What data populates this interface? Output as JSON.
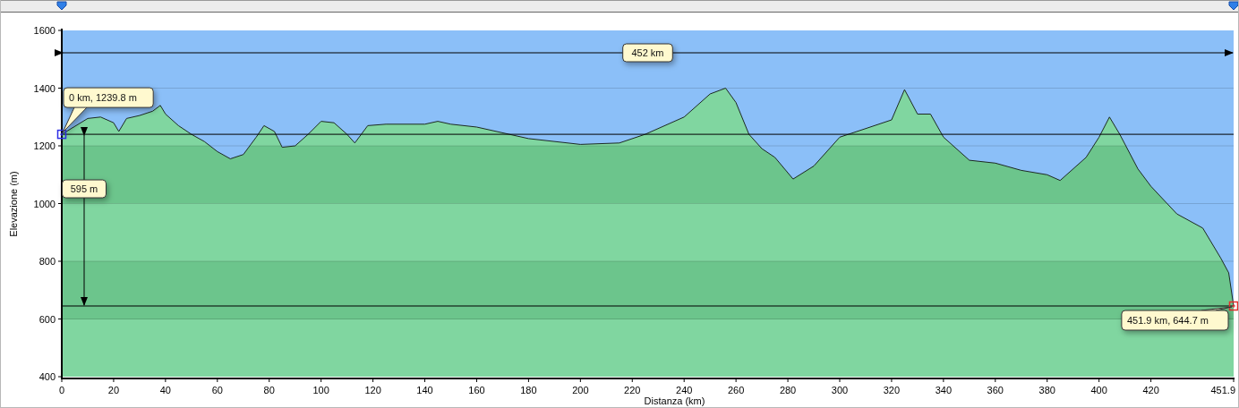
{
  "chart_data": {
    "type": "area",
    "xlabel": "Distanza   (km)",
    "ylabel": "Elevazione (m)",
    "x": [
      0,
      10,
      15,
      20,
      22,
      25,
      30,
      35,
      38,
      40,
      45,
      50,
      55,
      60,
      65,
      70,
      75,
      78,
      82,
      85,
      90,
      95,
      100,
      105,
      110,
      113,
      118,
      125,
      140,
      145,
      150,
      160,
      180,
      200,
      215,
      225,
      240,
      250,
      256,
      260,
      265,
      270,
      275,
      282,
      290,
      300,
      310,
      320,
      325,
      330,
      335,
      340,
      350,
      360,
      370,
      380,
      385,
      395,
      400,
      404,
      408,
      415,
      420,
      430,
      440,
      447,
      450,
      451.9
    ],
    "values": [
      1240,
      1295,
      1300,
      1280,
      1250,
      1295,
      1305,
      1320,
      1340,
      1310,
      1270,
      1240,
      1215,
      1180,
      1155,
      1170,
      1230,
      1270,
      1250,
      1195,
      1200,
      1240,
      1285,
      1280,
      1240,
      1210,
      1270,
      1275,
      1275,
      1285,
      1275,
      1265,
      1225,
      1205,
      1210,
      1240,
      1300,
      1380,
      1400,
      1350,
      1240,
      1190,
      1160,
      1085,
      1130,
      1230,
      1260,
      1290,
      1395,
      1310,
      1310,
      1230,
      1150,
      1140,
      1115,
      1100,
      1080,
      1160,
      1230,
      1300,
      1240,
      1120,
      1060,
      964,
      915,
      810,
      760,
      645
    ],
    "xlim": [
      0,
      451.9
    ],
    "ylim": [
      400,
      1600
    ],
    "xticks": [
      0,
      20,
      40,
      60,
      80,
      100,
      120,
      140,
      160,
      180,
      200,
      220,
      240,
      260,
      280,
      300,
      320,
      340,
      360,
      380,
      400,
      420,
      {
        "value": 451.9,
        "label": "451.9"
      }
    ],
    "yticks": [
      400,
      600,
      800,
      1000,
      1200,
      1400,
      1600
    ],
    "grid": true,
    "annotations": [
      "0 km, 1239.8 m",
      "451.9 km, 644.7 m",
      "452 km",
      "595 m"
    ]
  }
}
